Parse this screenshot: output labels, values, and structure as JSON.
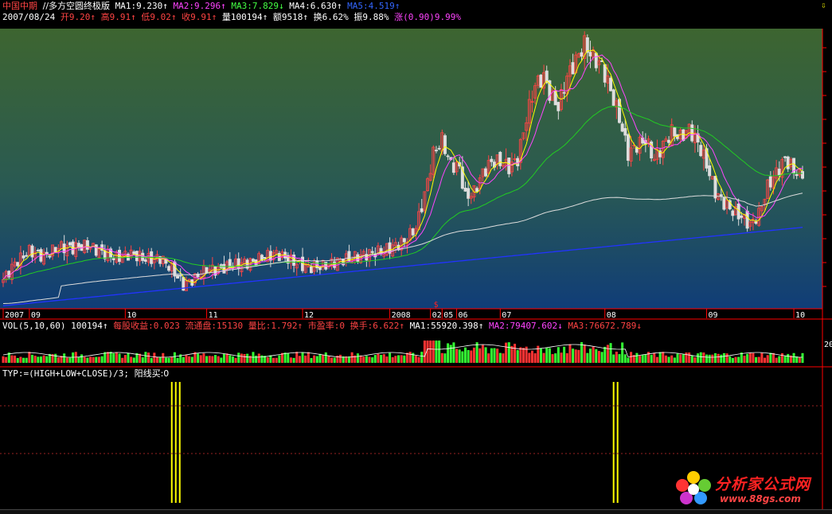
{
  "header": {
    "stock_name": "中国中期",
    "formula_name": "//多方空圆终极版",
    "ma_labels": [
      {
        "text": "MA1:9.230↑",
        "color": "#ffffff"
      },
      {
        "text": "MA2:9.296↑",
        "color": "#ff44ff"
      },
      {
        "text": "MA3:7.829↓",
        "color": "#44ff44"
      },
      {
        "text": "MA4:6.630↑",
        "color": "#ffffff"
      },
      {
        "text": "MA5:4.519↑",
        "color": "#3366ff"
      }
    ],
    "corner_icon": "lock-arrow-icon"
  },
  "info_bar": {
    "date": "2007/08/24",
    "items": [
      {
        "text": "开9.20↑",
        "color": "#ff4444"
      },
      {
        "text": "高9.91↑",
        "color": "#ff4444"
      },
      {
        "text": "低9.02↑",
        "color": "#ff4444"
      },
      {
        "text": "收9.91↑",
        "color": "#ff4444"
      },
      {
        "text": "量100194↑",
        "color": "#ffffff"
      },
      {
        "text": "额9518↑",
        "color": "#ffffff"
      },
      {
        "text": "换6.62%",
        "color": "#ffffff"
      },
      {
        "text": "振9.88%",
        "color": "#ffffff"
      },
      {
        "text": "涨(0.90)9.99%",
        "color": "#ff44ff"
      }
    ]
  },
  "vol_bar": {
    "items": [
      {
        "text": "VOL(5,10,60) 100194↑",
        "color": "#ffffff"
      },
      {
        "text": "每股收益:0.023",
        "color": "#ff4444"
      },
      {
        "text": "流通盘:15130",
        "color": "#ff4444"
      },
      {
        "text": "量比:1.792↑",
        "color": "#ff4444"
      },
      {
        "text": "市盈率:0",
        "color": "#ff4444"
      },
      {
        "text": "换手:6.622↑",
        "color": "#ff4444"
      },
      {
        "text": "MA1:55920.398↑",
        "color": "#ffffff"
      },
      {
        "text": "MA2:79407.602↓",
        "color": "#ff44ff"
      },
      {
        "text": "MA3:76672.789↓",
        "color": "#ff4444"
      }
    ],
    "axis_label": "20"
  },
  "indicator_bar": {
    "formula": "TYP:=(HIGH+LOW+CLOSE)/3;",
    "signal_label": "阳线买:0"
  },
  "watermark": {
    "brand_cn": "分析家公式网",
    "url": "www.88gs.com"
  },
  "colors": {
    "up": "#ff4444",
    "down": "#dddddd",
    "ma_short": "#ffff00",
    "ma_mid": "#ff44ff",
    "ma_long": "#22cc22",
    "ma_longer": "#dddddd",
    "ma_longest": "#2233ff",
    "vol_up": "#ff3333",
    "vol_down": "#33ff33",
    "signal": "#ffff00",
    "axis": "#ff0000"
  },
  "chart_data": {
    "type": "candlestick",
    "x_ticks": [
      "2007",
      "09",
      "10",
      "11",
      "12",
      "2008",
      "02",
      "05",
      "06",
      "07",
      "08",
      "09",
      "10"
    ],
    "x_tick_index": [
      0,
      9,
      42,
      70,
      103,
      133,
      147,
      151,
      156,
      171,
      207,
      242,
      272
    ],
    "split_marker": "$",
    "ylim": [
      6.2,
      16.3
    ],
    "anchor_close": [
      [
        0,
        7.2
      ],
      [
        4,
        7.8
      ],
      [
        9,
        8.25
      ],
      [
        14,
        8.05
      ],
      [
        19,
        8.4
      ],
      [
        24,
        8.35
      ],
      [
        29,
        8.45
      ],
      [
        34,
        8.2
      ],
      [
        39,
        8.0
      ],
      [
        44,
        8.15
      ],
      [
        49,
        7.95
      ],
      [
        54,
        8.0
      ],
      [
        58,
        7.6
      ],
      [
        62,
        7.0
      ],
      [
        66,
        7.25
      ],
      [
        70,
        7.6
      ],
      [
        74,
        7.55
      ],
      [
        78,
        7.7
      ],
      [
        82,
        7.8
      ],
      [
        86,
        7.85
      ],
      [
        90,
        8.05
      ],
      [
        94,
        8.15
      ],
      [
        98,
        7.95
      ],
      [
        102,
        7.75
      ],
      [
        106,
        7.65
      ],
      [
        110,
        7.7
      ],
      [
        114,
        7.85
      ],
      [
        118,
        7.95
      ],
      [
        122,
        8.05
      ],
      [
        126,
        8.15
      ],
      [
        130,
        8.25
      ],
      [
        134,
        8.4
      ],
      [
        138,
        8.6
      ],
      [
        142,
        9.1
      ],
      [
        145,
        10.3
      ],
      [
        148,
        11.8
      ],
      [
        151,
        12.3
      ],
      [
        154,
        11.4
      ],
      [
        157,
        11.3
      ],
      [
        159,
        10.2
      ],
      [
        162,
        10.4
      ],
      [
        165,
        11.1
      ],
      [
        168,
        11.5
      ],
      [
        171,
        11.5
      ],
      [
        174,
        11.3
      ],
      [
        177,
        11.6
      ],
      [
        180,
        13.1
      ],
      [
        183,
        14.3
      ],
      [
        186,
        14.6
      ],
      [
        188,
        14.0
      ],
      [
        191,
        13.5
      ],
      [
        194,
        14.6
      ],
      [
        197,
        15.2
      ],
      [
        200,
        15.8
      ],
      [
        203,
        15.3
      ],
      [
        206,
        15.0
      ],
      [
        209,
        14.1
      ],
      [
        212,
        13.1
      ],
      [
        215,
        11.8
      ],
      [
        218,
        12.1
      ],
      [
        221,
        12.3
      ],
      [
        224,
        11.6
      ],
      [
        227,
        12.1
      ],
      [
        230,
        12.6
      ],
      [
        233,
        12.4
      ],
      [
        236,
        12.7
      ],
      [
        239,
        12.2
      ],
      [
        242,
        11.4
      ],
      [
        245,
        10.4
      ],
      [
        248,
        10.0
      ],
      [
        251,
        9.7
      ],
      [
        254,
        9.5
      ],
      [
        257,
        9.2
      ],
      [
        260,
        9.6
      ],
      [
        263,
        10.6
      ],
      [
        266,
        11.1
      ],
      [
        269,
        11.6
      ],
      [
        272,
        11.2
      ],
      [
        275,
        10.9
      ]
    ],
    "volume_range": [
      20000,
      100194
    ],
    "signal_bars": [
      {
        "index": 58,
        "count": 3
      },
      {
        "index": 210,
        "count": 2
      }
    ]
  }
}
